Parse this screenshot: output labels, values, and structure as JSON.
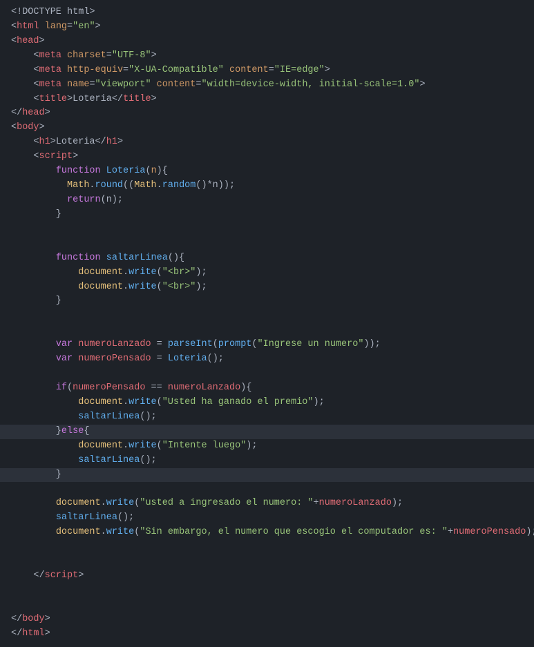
{
  "code": {
    "lines": [
      {
        "id": 1,
        "tokens": [
          {
            "t": "<!DOCTYPE html>",
            "c": "c-gray"
          }
        ]
      },
      {
        "id": 2,
        "tokens": [
          {
            "t": "<",
            "c": "c-gray"
          },
          {
            "t": "html",
            "c": "c-tag"
          },
          {
            "t": " ",
            "c": "c-gray"
          },
          {
            "t": "lang",
            "c": "c-attr"
          },
          {
            "t": "=",
            "c": "c-gray"
          },
          {
            "t": "\"en\"",
            "c": "c-val"
          },
          {
            "t": ">",
            "c": "c-gray"
          }
        ]
      },
      {
        "id": 3,
        "tokens": [
          {
            "t": "<",
            "c": "c-gray"
          },
          {
            "t": "head",
            "c": "c-tag"
          },
          {
            "t": ">",
            "c": "c-gray"
          }
        ]
      },
      {
        "id": 4,
        "tokens": [
          {
            "t": "    <",
            "c": "c-gray"
          },
          {
            "t": "meta",
            "c": "c-tag"
          },
          {
            "t": " ",
            "c": "c-gray"
          },
          {
            "t": "charset",
            "c": "c-attr"
          },
          {
            "t": "=",
            "c": "c-gray"
          },
          {
            "t": "\"UTF-8\"",
            "c": "c-val"
          },
          {
            "t": ">",
            "c": "c-gray"
          }
        ]
      },
      {
        "id": 5,
        "tokens": [
          {
            "t": "    <",
            "c": "c-gray"
          },
          {
            "t": "meta",
            "c": "c-tag"
          },
          {
            "t": " ",
            "c": "c-gray"
          },
          {
            "t": "http-equiv",
            "c": "c-attr"
          },
          {
            "t": "=",
            "c": "c-gray"
          },
          {
            "t": "\"X-UA-Compatible\"",
            "c": "c-val"
          },
          {
            "t": " ",
            "c": "c-gray"
          },
          {
            "t": "content",
            "c": "c-attr"
          },
          {
            "t": "=",
            "c": "c-gray"
          },
          {
            "t": "\"IE=edge\"",
            "c": "c-val"
          },
          {
            "t": ">",
            "c": "c-gray"
          }
        ]
      },
      {
        "id": 6,
        "tokens": [
          {
            "t": "    <",
            "c": "c-gray"
          },
          {
            "t": "meta",
            "c": "c-tag"
          },
          {
            "t": " ",
            "c": "c-gray"
          },
          {
            "t": "name",
            "c": "c-attr"
          },
          {
            "t": "=",
            "c": "c-gray"
          },
          {
            "t": "\"viewport\"",
            "c": "c-val"
          },
          {
            "t": " ",
            "c": "c-gray"
          },
          {
            "t": "content",
            "c": "c-attr"
          },
          {
            "t": "=",
            "c": "c-gray"
          },
          {
            "t": "\"width=device-width, initial-scale=1.0\"",
            "c": "c-val"
          },
          {
            "t": ">",
            "c": "c-gray"
          }
        ]
      },
      {
        "id": 7,
        "tokens": [
          {
            "t": "    <",
            "c": "c-gray"
          },
          {
            "t": "title",
            "c": "c-tag"
          },
          {
            "t": ">",
            "c": "c-gray"
          },
          {
            "t": "Loteria",
            "c": "c-gray"
          },
          {
            "t": "</",
            "c": "c-gray"
          },
          {
            "t": "title",
            "c": "c-tag"
          },
          {
            "t": ">",
            "c": "c-gray"
          }
        ]
      },
      {
        "id": 8,
        "tokens": [
          {
            "t": "</",
            "c": "c-gray"
          },
          {
            "t": "head",
            "c": "c-tag"
          },
          {
            "t": ">",
            "c": "c-gray"
          }
        ]
      },
      {
        "id": 9,
        "tokens": [
          {
            "t": "<",
            "c": "c-gray"
          },
          {
            "t": "body",
            "c": "c-tag"
          },
          {
            "t": ">",
            "c": "c-gray"
          }
        ]
      },
      {
        "id": 10,
        "tokens": [
          {
            "t": "    <",
            "c": "c-gray"
          },
          {
            "t": "h1",
            "c": "c-tag"
          },
          {
            "t": ">",
            "c": "c-gray"
          },
          {
            "t": "Loteria",
            "c": "c-gray"
          },
          {
            "t": "</",
            "c": "c-gray"
          },
          {
            "t": "h1",
            "c": "c-tag"
          },
          {
            "t": ">",
            "c": "c-gray"
          }
        ]
      },
      {
        "id": 11,
        "tokens": [
          {
            "t": "    <",
            "c": "c-gray"
          },
          {
            "t": "script",
            "c": "c-tag"
          },
          {
            "t": ">",
            "c": "c-gray"
          }
        ]
      },
      {
        "id": 12,
        "tokens": [
          {
            "t": "        ",
            "c": "c-gray"
          },
          {
            "t": "function",
            "c": "c-pink"
          },
          {
            "t": " ",
            "c": "c-gray"
          },
          {
            "t": "Loteria",
            "c": "c-blue"
          },
          {
            "t": "(",
            "c": "c-gray"
          },
          {
            "t": "n",
            "c": "c-orange"
          },
          {
            "t": "){",
            "c": "c-gray"
          }
        ]
      },
      {
        "id": 13,
        "tokens": [
          {
            "t": "          ",
            "c": "c-gray"
          },
          {
            "t": "Math",
            "c": "c-yellow"
          },
          {
            "t": ".",
            "c": "c-gray"
          },
          {
            "t": "round",
            "c": "c-blue"
          },
          {
            "t": "((",
            "c": "c-gray"
          },
          {
            "t": "Math",
            "c": "c-yellow"
          },
          {
            "t": ".",
            "c": "c-gray"
          },
          {
            "t": "random",
            "c": "c-blue"
          },
          {
            "t": "()*n));",
            "c": "c-gray"
          }
        ]
      },
      {
        "id": 14,
        "tokens": [
          {
            "t": "          ",
            "c": "c-gray"
          },
          {
            "t": "return",
            "c": "c-pink"
          },
          {
            "t": "(n);",
            "c": "c-gray"
          }
        ]
      },
      {
        "id": 15,
        "tokens": [
          {
            "t": "        }",
            "c": "c-gray"
          }
        ]
      },
      {
        "id": 16,
        "tokens": []
      },
      {
        "id": 17,
        "tokens": []
      },
      {
        "id": 18,
        "tokens": [
          {
            "t": "        ",
            "c": "c-gray"
          },
          {
            "t": "function",
            "c": "c-pink"
          },
          {
            "t": " ",
            "c": "c-gray"
          },
          {
            "t": "saltarLinea",
            "c": "c-blue"
          },
          {
            "t": "(){",
            "c": "c-gray"
          }
        ]
      },
      {
        "id": 19,
        "tokens": [
          {
            "t": "            ",
            "c": "c-gray"
          },
          {
            "t": "document",
            "c": "c-yellow"
          },
          {
            "t": ".",
            "c": "c-gray"
          },
          {
            "t": "write",
            "c": "c-blue"
          },
          {
            "t": "(",
            "c": "c-gray"
          },
          {
            "t": "\"<br>\"",
            "c": "c-green"
          },
          {
            "t": ");",
            "c": "c-gray"
          }
        ]
      },
      {
        "id": 20,
        "tokens": [
          {
            "t": "            ",
            "c": "c-gray"
          },
          {
            "t": "document",
            "c": "c-yellow"
          },
          {
            "t": ".",
            "c": "c-gray"
          },
          {
            "t": "write",
            "c": "c-blue"
          },
          {
            "t": "(",
            "c": "c-gray"
          },
          {
            "t": "\"<br>\"",
            "c": "c-green"
          },
          {
            "t": ");",
            "c": "c-gray"
          }
        ]
      },
      {
        "id": 21,
        "tokens": [
          {
            "t": "        }",
            "c": "c-gray"
          }
        ]
      },
      {
        "id": 22,
        "tokens": []
      },
      {
        "id": 23,
        "tokens": []
      },
      {
        "id": 24,
        "tokens": [
          {
            "t": "        ",
            "c": "c-gray"
          },
          {
            "t": "var",
            "c": "c-pink"
          },
          {
            "t": " ",
            "c": "c-gray"
          },
          {
            "t": "numeroLanzado",
            "c": "c-red"
          },
          {
            "t": " = ",
            "c": "c-gray"
          },
          {
            "t": "parseInt",
            "c": "c-blue"
          },
          {
            "t": "(",
            "c": "c-gray"
          },
          {
            "t": "prompt",
            "c": "c-blue"
          },
          {
            "t": "(",
            "c": "c-gray"
          },
          {
            "t": "\"Ingrese un numero\"",
            "c": "c-green"
          },
          {
            "t": "));",
            "c": "c-gray"
          }
        ]
      },
      {
        "id": 25,
        "tokens": [
          {
            "t": "        ",
            "c": "c-gray"
          },
          {
            "t": "var",
            "c": "c-pink"
          },
          {
            "t": " ",
            "c": "c-gray"
          },
          {
            "t": "numeroPensado",
            "c": "c-red"
          },
          {
            "t": " = ",
            "c": "c-gray"
          },
          {
            "t": "Loteria",
            "c": "c-blue"
          },
          {
            "t": "();",
            "c": "c-gray"
          }
        ]
      },
      {
        "id": 26,
        "tokens": []
      },
      {
        "id": 27,
        "tokens": [
          {
            "t": "        ",
            "c": "c-gray"
          },
          {
            "t": "if",
            "c": "c-pink"
          },
          {
            "t": "(",
            "c": "c-gray"
          },
          {
            "t": "numeroPensado",
            "c": "c-red"
          },
          {
            "t": " == ",
            "c": "c-gray"
          },
          {
            "t": "numeroLanzado",
            "c": "c-red"
          },
          {
            "t": "){",
            "c": "c-gray"
          }
        ]
      },
      {
        "id": 28,
        "tokens": [
          {
            "t": "            ",
            "c": "c-gray"
          },
          {
            "t": "document",
            "c": "c-yellow"
          },
          {
            "t": ".",
            "c": "c-gray"
          },
          {
            "t": "write",
            "c": "c-blue"
          },
          {
            "t": "(",
            "c": "c-gray"
          },
          {
            "t": "\"Usted ha ganado el premio\"",
            "c": "c-green"
          },
          {
            "t": ");",
            "c": "c-gray"
          }
        ]
      },
      {
        "id": 29,
        "tokens": [
          {
            "t": "            ",
            "c": "c-gray"
          },
          {
            "t": "saltarLinea",
            "c": "c-blue"
          },
          {
            "t": "();",
            "c": "c-gray"
          }
        ]
      },
      {
        "id": 30,
        "tokens": [
          {
            "t": "        }",
            "c": "c-gray"
          },
          {
            "t": "else",
            "c": "c-pink"
          },
          {
            "t": "{",
            "c": "c-gray"
          }
        ],
        "highlight": true
      },
      {
        "id": 31,
        "tokens": [
          {
            "t": "            ",
            "c": "c-gray"
          },
          {
            "t": "document",
            "c": "c-yellow"
          },
          {
            "t": ".",
            "c": "c-gray"
          },
          {
            "t": "write",
            "c": "c-blue"
          },
          {
            "t": "(",
            "c": "c-gray"
          },
          {
            "t": "\"Intente luego\"",
            "c": "c-green"
          },
          {
            "t": ");",
            "c": "c-gray"
          }
        ]
      },
      {
        "id": 32,
        "tokens": [
          {
            "t": "            ",
            "c": "c-gray"
          },
          {
            "t": "saltarLinea",
            "c": "c-blue"
          },
          {
            "t": "();",
            "c": "c-gray"
          }
        ]
      },
      {
        "id": 33,
        "tokens": [
          {
            "t": "        }",
            "c": "c-gray"
          }
        ],
        "highlight": true
      },
      {
        "id": 34,
        "tokens": []
      },
      {
        "id": 35,
        "tokens": [
          {
            "t": "        ",
            "c": "c-gray"
          },
          {
            "t": "document",
            "c": "c-yellow"
          },
          {
            "t": ".",
            "c": "c-gray"
          },
          {
            "t": "write",
            "c": "c-blue"
          },
          {
            "t": "(",
            "c": "c-gray"
          },
          {
            "t": "\"usted a ingresado el numero: \"",
            "c": "c-green"
          },
          {
            "t": "+",
            "c": "c-gray"
          },
          {
            "t": "numeroLanzado",
            "c": "c-red"
          },
          {
            "t": ");",
            "c": "c-gray"
          }
        ]
      },
      {
        "id": 36,
        "tokens": [
          {
            "t": "        ",
            "c": "c-gray"
          },
          {
            "t": "saltarLinea",
            "c": "c-blue"
          },
          {
            "t": "();",
            "c": "c-gray"
          }
        ]
      },
      {
        "id": 37,
        "tokens": [
          {
            "t": "        ",
            "c": "c-gray"
          },
          {
            "t": "document",
            "c": "c-yellow"
          },
          {
            "t": ".",
            "c": "c-gray"
          },
          {
            "t": "write",
            "c": "c-blue"
          },
          {
            "t": "(",
            "c": "c-gray"
          },
          {
            "t": "\"Sin embargo, el numero que escogio el computador es: \"",
            "c": "c-green"
          },
          {
            "t": "+",
            "c": "c-gray"
          },
          {
            "t": "numeroPensado",
            "c": "c-red"
          },
          {
            "t": ");",
            "c": "c-gray"
          }
        ]
      },
      {
        "id": 38,
        "tokens": []
      },
      {
        "id": 39,
        "tokens": []
      },
      {
        "id": 40,
        "tokens": [
          {
            "t": "    </",
            "c": "c-gray"
          },
          {
            "t": "script",
            "c": "c-tag"
          },
          {
            "t": ">",
            "c": "c-gray"
          }
        ]
      },
      {
        "id": 41,
        "tokens": []
      },
      {
        "id": 42,
        "tokens": []
      },
      {
        "id": 43,
        "tokens": [
          {
            "t": "</",
            "c": "c-gray"
          },
          {
            "t": "body",
            "c": "c-tag"
          },
          {
            "t": ">",
            "c": "c-gray"
          }
        ]
      },
      {
        "id": 44,
        "tokens": [
          {
            "t": "</",
            "c": "c-gray"
          },
          {
            "t": "html",
            "c": "c-tag"
          },
          {
            "t": ">",
            "c": "c-gray"
          }
        ]
      }
    ]
  }
}
